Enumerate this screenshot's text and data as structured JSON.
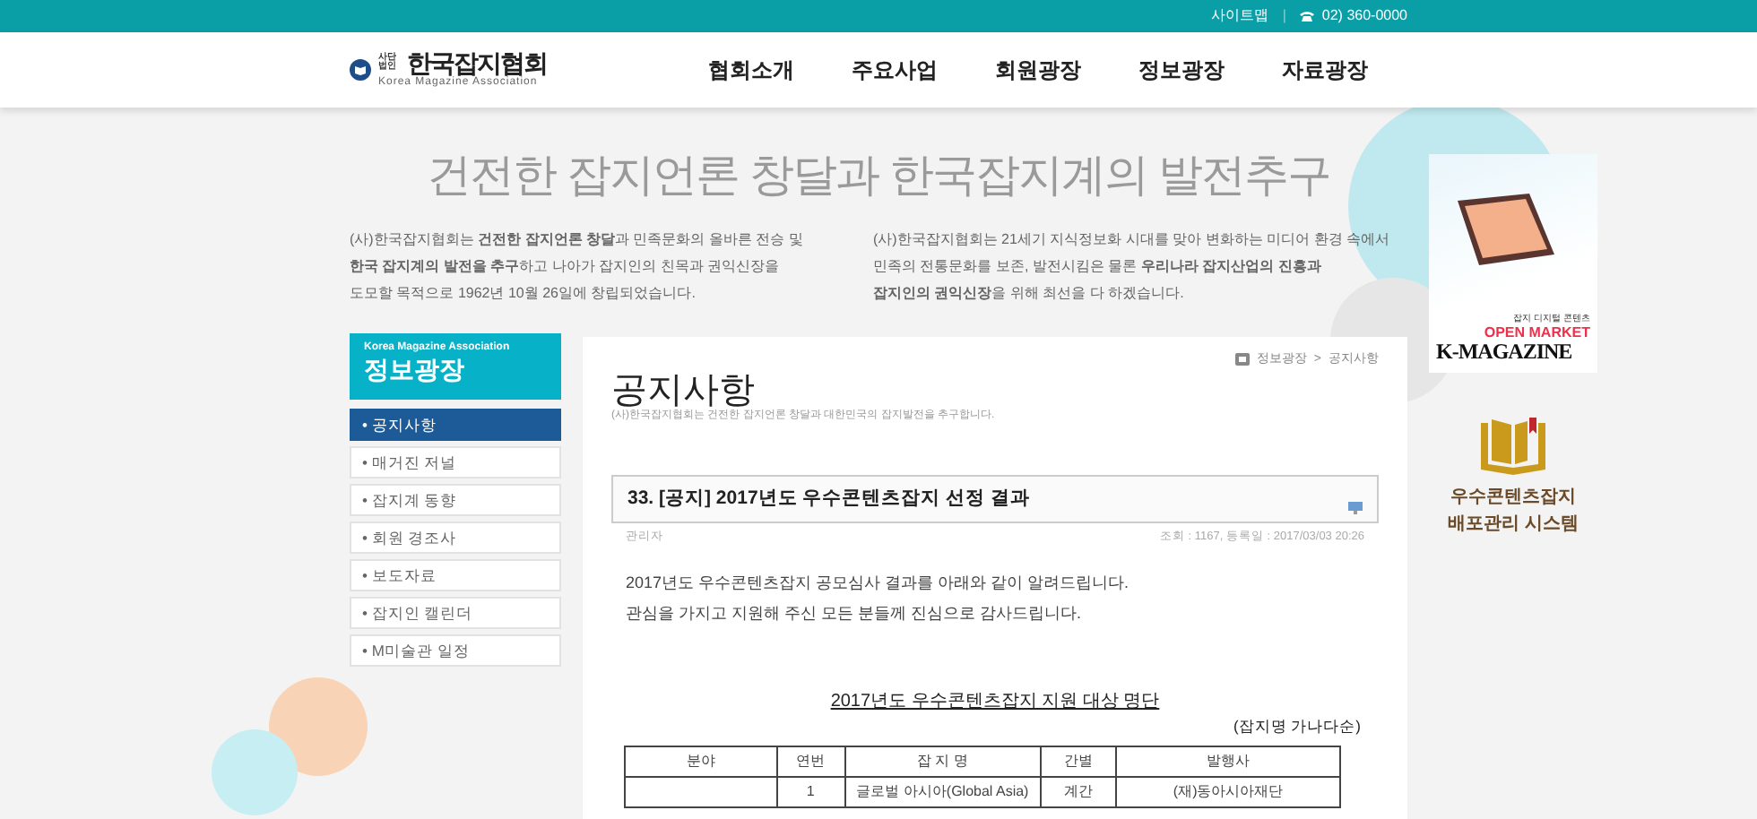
{
  "top_bar": {
    "sitemap": "사이트맵",
    "separator": "|",
    "phone": "02) 360-0000"
  },
  "header": {
    "logo_mark": "사단법인",
    "logo_title": "한국잡지협회",
    "logo_subtitle": "Korea  Magazine Association",
    "nav": [
      {
        "label": "협회소개"
      },
      {
        "label": "주요사업"
      },
      {
        "label": "회원광장"
      },
      {
        "label": "정보광장"
      },
      {
        "label": "자료광장"
      }
    ]
  },
  "hero": {
    "tagline": "건전한 잡지언론 창달과 한국잡지계의 발전추구",
    "paragraphs": [
      [
        "(사)한국잡지협회는 **건전한 잡지언론 창달**과 민족문화의 올바른 전승 및",
        "**한국 잡지계의 발전을 추구**하고 나아가 잡지인의 친목과 권익신장을",
        "도모할 목적으로 1962년 10월 26일에 창립되었습니다."
      ],
      [
        "(사)한국잡지협회는 21세기 지식정보화 시대를 맞아 변화하는 미디어 환경 속에서",
        "민족의 전통문화를 보존, 발전시킴은 물론 **우리나라 잡지산업의 진흥과**",
        "**잡지인의 권익신장**을 위해 최선을 다 하겠습니다."
      ]
    ]
  },
  "sidebar": {
    "subtitle": "Korea Magazine Association",
    "title": "정보광장",
    "items": [
      {
        "label": "• 공지사항",
        "selected": true
      },
      {
        "label": "• 매거진 저널",
        "selected": false
      },
      {
        "label": "• 잡지계 동향",
        "selected": false
      },
      {
        "label": "• 회원 경조사",
        "selected": false
      },
      {
        "label": "• 보도자료",
        "selected": false
      },
      {
        "label": "• 잡지인 캘린더",
        "selected": false
      },
      {
        "label": "• M미술관 일정",
        "selected": false
      }
    ]
  },
  "content": {
    "breadcrumb": [
      "정보광장",
      "공지사항"
    ],
    "breadcrumb_separator": ">",
    "title": "공지사항",
    "subtitle": "(사)한국잡지협회는 건전한 잡지언론 창달과 대한민국의 잡지발전을 추구합니다.",
    "post": {
      "title": "33. [공지] 2017년도 우수콘텐츠잡지 선정 결과",
      "author": "관리자",
      "meta": "조회 : 1167, 등록일 : 2017/03/03 20:26",
      "body": [
        "2017년도 우수콘텐츠잡지 공모심사 결과를 아래와 같이 알려드립니다.",
        "관심을 가지고 지원해 주신 모든 분들께 진심으로 감사드립니다."
      ],
      "table_title": "2017년도 우수콘텐츠잡지 지원 대상 명단",
      "table_note": "(잡지명 가나다순)",
      "table": {
        "columns": [
          "분야",
          "연번",
          "잡 지 명",
          "간별",
          "발행사"
        ],
        "rows": [
          [
            "",
            "1",
            "글로벌 아시아(Global Asia)",
            "계간",
            "(재)동아시아재단"
          ]
        ]
      }
    }
  },
  "right": {
    "banner": {
      "caption": "잡지 디지털 콘텐츠",
      "headline": "OPEN MARKET",
      "brand": "K-MAGAZINE"
    },
    "system_link": [
      "우수콘텐츠잡지",
      "배포관리 시스템"
    ]
  }
}
